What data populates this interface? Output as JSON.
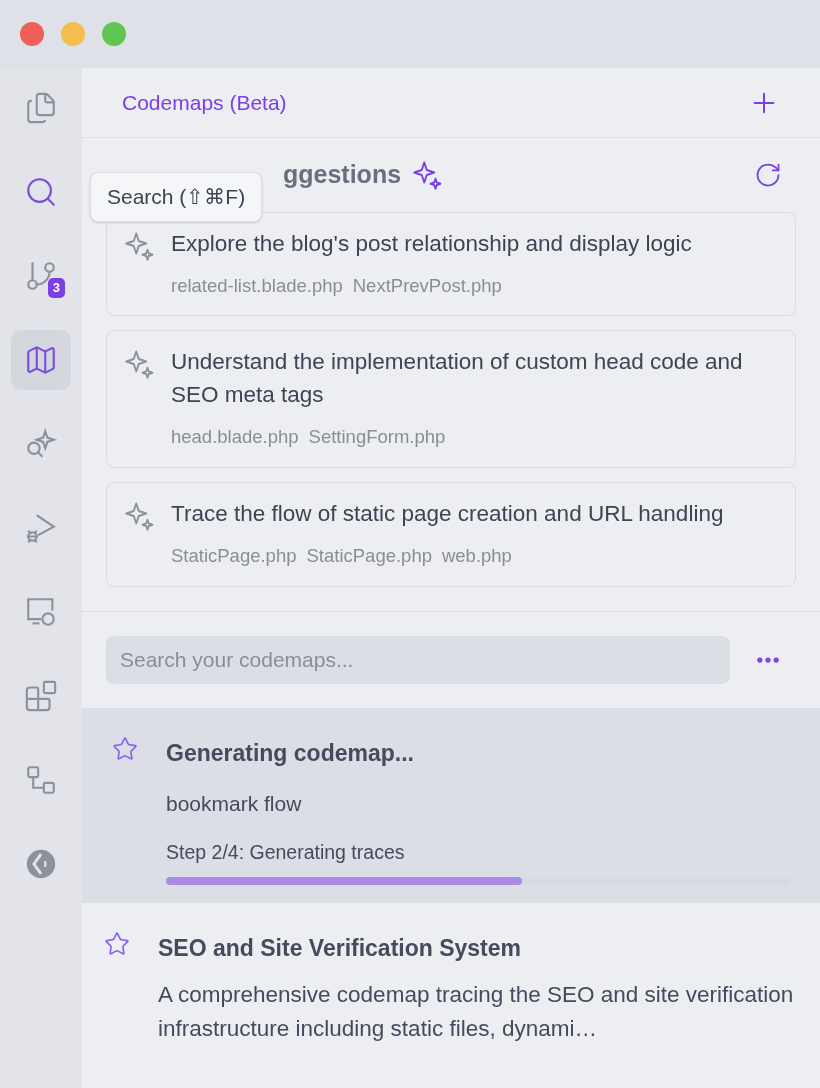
{
  "sidebar": {
    "items": [
      {
        "selected": false,
        "hovered": false
      },
      {
        "selected": false,
        "hovered": true
      },
      {
        "selected": false,
        "hovered": false,
        "badge": "3"
      },
      {
        "selected": true,
        "hovered": false
      },
      {
        "selected": false,
        "hovered": false
      },
      {
        "selected": false,
        "hovered": false
      },
      {
        "selected": false,
        "hovered": false
      },
      {
        "selected": false,
        "hovered": false
      },
      {
        "selected": false,
        "hovered": false
      },
      {
        "selected": false,
        "hovered": false
      }
    ]
  },
  "tooltip": "Search (⇧⌘F)",
  "header": {
    "title": "Codemaps (Beta)"
  },
  "suggestions": {
    "title": "ggestions",
    "items": [
      {
        "text": "Explore the blog's post relationship and display logic",
        "files": [
          "related-list.blade.php",
          "NextPrevPost.php"
        ]
      },
      {
        "text": "Understand the implementation of custom head code and SEO meta tags",
        "files": [
          "head.blade.php",
          "SettingForm.php"
        ]
      },
      {
        "text": "Trace the flow of static page creation and URL handling",
        "files": [
          "StaticPage.php",
          "StaticPage.php",
          "web.php"
        ]
      }
    ]
  },
  "search": {
    "placeholder": "Search your codemaps..."
  },
  "codemaps": [
    {
      "kind": "generating",
      "title": "Generating codemap...",
      "subtitle": "bookmark flow",
      "step": "Step 2/4: Generating traces",
      "level": 0.57,
      "starred": false
    },
    {
      "kind": "done",
      "title": "SEO and Site Verification System",
      "description": "A comprehensive codemap tracing the SEO and site verification infrastructure including static files, dynami…",
      "starred": false
    }
  ]
}
